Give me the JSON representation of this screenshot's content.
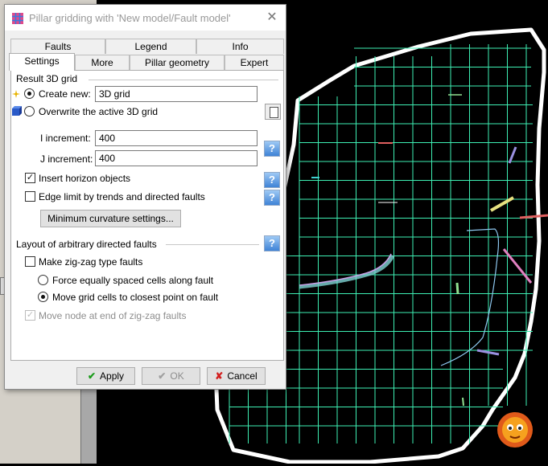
{
  "dialog": {
    "title": "Pillar gridding with 'New model/Fault model'",
    "close_glyph": "✕",
    "tabs_row1": [
      "Faults",
      "Legend",
      "Info"
    ],
    "tabs_row2": [
      "Settings",
      "More",
      "Pillar geometry",
      "Expert"
    ],
    "active_tab": "Settings",
    "result_group": "Result 3D grid",
    "create_new_label": "Create new:",
    "create_new_value": "3D grid",
    "overwrite_label": "Overwrite the active 3D grid",
    "i_increment_label": "I increment:",
    "i_increment_value": "400",
    "j_increment_label": "J increment:",
    "j_increment_value": "400",
    "insert_horizon_label": "Insert horizon objects",
    "edge_limit_label": "Edge limit by trends and directed faults",
    "min_curvature_button": "Minimum curvature settings...",
    "layout_group": "Layout of arbitrary directed faults",
    "zigzag_label": "Make zig-zag type faults",
    "force_equal_label": "Force equally spaced cells along fault",
    "move_grid_label": "Move grid cells to closest point on fault",
    "move_node_label": "Move node at end of zig-zag faults",
    "help_glyph": "?",
    "apply_label": "Apply",
    "ok_label": "OK",
    "cancel_label": "Cancel",
    "icons": {
      "apply": "checkmark-icon",
      "ok": "checkmark-icon",
      "cancel": "x-icon"
    },
    "state": {
      "create_new": true,
      "overwrite": false,
      "insert_horizon": true,
      "edge_limit": false,
      "zigzag": false,
      "force_equal": false,
      "move_grid": true,
      "move_node": true,
      "move_node_disabled": true,
      "ok_disabled": true
    }
  },
  "colors": {
    "grid": "#3ef0b4",
    "boundary": "#ffffff",
    "background": "#000000",
    "help": "#3f83d6",
    "apply_check": "#1a9b1a",
    "cancel_x": "#d21e1e"
  }
}
